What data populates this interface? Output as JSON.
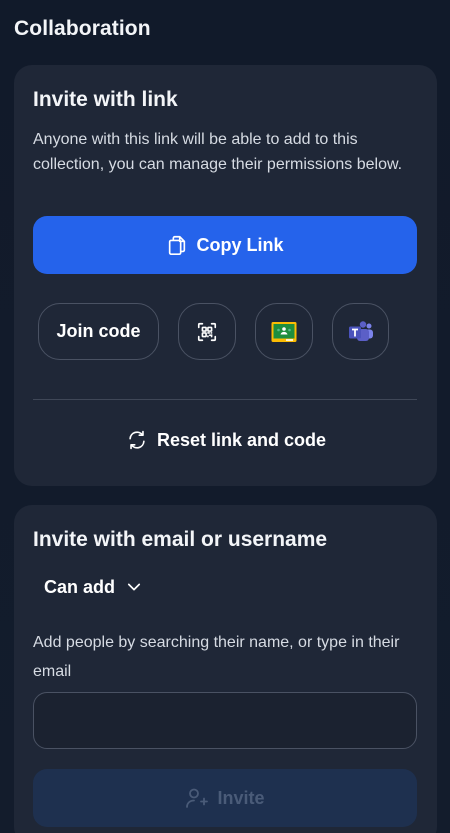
{
  "page": {
    "title": "Collaboration"
  },
  "invite_link": {
    "title": "Invite with link",
    "description": "Anyone with this link will be able to add to this collection, you can manage their permissions below.",
    "copy_button": {
      "label": "Copy Link",
      "icon": "copy-icon"
    },
    "share_options": [
      {
        "label": "Join code"
      },
      {
        "icon": "qr-code-icon"
      },
      {
        "icon": "google-classroom-icon"
      },
      {
        "icon": "microsoft-teams-icon"
      }
    ],
    "reset_button": {
      "label": "Reset link and code",
      "icon": "refresh-icon"
    }
  },
  "invite_email": {
    "title": "Invite with email or username",
    "permission": {
      "selected": "Can add",
      "icon": "chevron-down-icon"
    },
    "help_text": "Add people by searching their name, or type in their email",
    "input": {
      "value": "",
      "placeholder": ""
    },
    "invite_button": {
      "label": "Invite",
      "icon": "add-user-icon",
      "disabled": true
    }
  },
  "colors": {
    "background": "#111a2a",
    "card": "#1f2737",
    "primary": "#2563eb",
    "primary_disabled": "#1e304f",
    "classroom_green": "#1e8e3e",
    "classroom_yellow": "#fbbc04",
    "teams_purple": "#5b5fc7"
  }
}
